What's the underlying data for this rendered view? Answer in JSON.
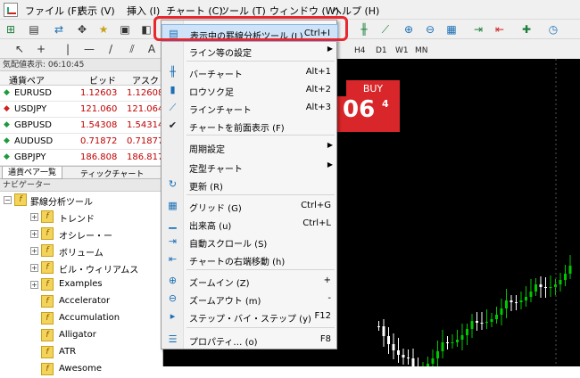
{
  "menubar": {
    "items": [
      {
        "label": "ファイル (F)"
      },
      {
        "label": "表示 (V)"
      },
      {
        "label": "挿入 (I)"
      },
      {
        "label": "チャート (C)"
      },
      {
        "label": "ツール (T)"
      },
      {
        "label": "ウィンドウ (W)"
      },
      {
        "label": "ヘルプ (H)"
      }
    ]
  },
  "timeframes": [
    "H4",
    "D1",
    "W1",
    "MN"
  ],
  "market_watch": {
    "title": "気配値表示: 06:10:45",
    "headers": {
      "symbol": "通貨ペア",
      "bid": "ビッド",
      "ask": "アスク"
    },
    "rows": [
      {
        "symbol": "EURUSD",
        "bid": "1.12603",
        "ask": "1.12608",
        "direction": "up"
      },
      {
        "symbol": "USDJPY",
        "bid": "121.060",
        "ask": "121.064",
        "direction": "down"
      },
      {
        "symbol": "GBPUSD",
        "bid": "1.54308",
        "ask": "1.54314",
        "direction": "up"
      },
      {
        "symbol": "AUDUSD",
        "bid": "0.71872",
        "ask": "0.71877",
        "direction": "up"
      },
      {
        "symbol": "GBPJPY",
        "bid": "186.808",
        "ask": "186.817",
        "direction": "up"
      }
    ],
    "tabs": [
      "通貨ペア一覧",
      "ティックチャート"
    ]
  },
  "navigator": {
    "title": "ナビゲーター",
    "root": "罫線分析ツール",
    "folders": [
      "トレンド",
      "オシレー・ー",
      "ボリューム",
      "ビル・ウィリアムス",
      "Examples"
    ],
    "indicators": [
      "Accelerator",
      "Accumulation",
      "Alligator",
      "ATR",
      "Awesome"
    ]
  },
  "chart": {
    "buy_label": "BUY",
    "buy_big": "06",
    "buy_small": "4",
    "background": "#000000",
    "bull_color": "#00c800",
    "bear_color": "#ffffff"
  },
  "context_menu": {
    "items": [
      {
        "label": "表示中の罫線分析ツール (L)",
        "shortcut": "Ctrl+I",
        "icon": "indicator-list-icon"
      },
      {
        "label": "ライン等の設定",
        "shortcut": "",
        "submenu": true,
        "icon": ""
      },
      {
        "label": "バーチャート",
        "shortcut": "Alt+1",
        "icon": "bar-chart-icon"
      },
      {
        "label": "ロウソク足",
        "shortcut": "Alt+2",
        "icon": "candlestick-icon"
      },
      {
        "label": "ラインチャート",
        "shortcut": "Alt+3",
        "icon": "line-chart-icon"
      },
      {
        "label": "チャートを前面表示 (F)",
        "shortcut": "",
        "icon": "checkmark-icon"
      },
      {
        "label": "周期設定",
        "shortcut": "",
        "submenu": true,
        "icon": ""
      },
      {
        "label": "定型チャート",
        "shortcut": "",
        "submenu": true,
        "icon": ""
      },
      {
        "label": "更新 (R)",
        "shortcut": "",
        "icon": "refresh-icon"
      },
      {
        "label": "グリッド (G)",
        "shortcut": "Ctrl+G",
        "icon": "grid-icon"
      },
      {
        "label": "出来高 (u)",
        "shortcut": "Ctrl+L",
        "icon": "volume-icon"
      },
      {
        "label": "自動スクロール (S)",
        "shortcut": "",
        "icon": "autoscroll-icon"
      },
      {
        "label": "チャートの右端移動 (h)",
        "shortcut": "",
        "icon": "shift-end-icon"
      },
      {
        "label": "ズームイン (Z)",
        "shortcut": "+",
        "icon": "zoom-in-icon"
      },
      {
        "label": "ズームアウト (m)",
        "shortcut": "-",
        "icon": "zoom-out-icon"
      },
      {
        "label": "ステップ・バイ・ステップ (y)",
        "shortcut": "F12",
        "icon": "step-icon"
      },
      {
        "label": "プロパティ… (o)",
        "shortcut": "F8",
        "icon": "properties-icon"
      }
    ]
  }
}
